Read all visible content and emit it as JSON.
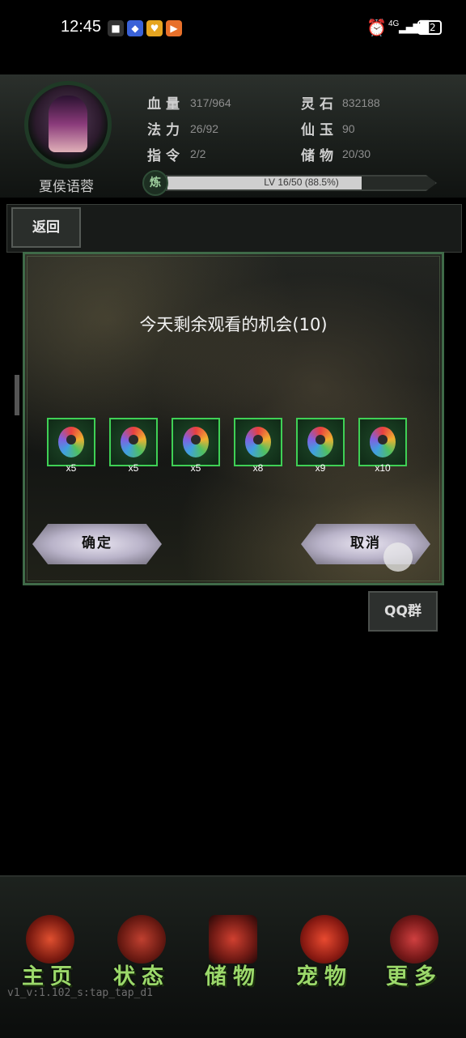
{
  "status_bar": {
    "time": "12:45",
    "network": "4G",
    "battery": "12"
  },
  "player": {
    "name": "夏侯语蓉",
    "stats": [
      {
        "label": "血量",
        "value": "317/964"
      },
      {
        "label": "法力",
        "value": "26/92"
      },
      {
        "label": "指令",
        "value": "2/2"
      },
      {
        "label": "灵石",
        "value": "832188"
      },
      {
        "label": "仙玉",
        "value": "90"
      },
      {
        "label": "储物",
        "value": "20/30"
      }
    ],
    "exp_badge": "炼",
    "exp_text": "LV 16/50 (88.5%)",
    "exp_progress": 0.885
  },
  "nav": {
    "back_label": "返回"
  },
  "dialog": {
    "title": "今天剩余观看的机会(10)",
    "rewards": [
      {
        "qty": "x5",
        "icon": "spirit-gem-icon"
      },
      {
        "qty": "x5",
        "icon": "spirit-gem-icon"
      },
      {
        "qty": "x5",
        "icon": "spirit-gem-icon"
      },
      {
        "qty": "x8",
        "icon": "spirit-gem-icon"
      },
      {
        "qty": "x9",
        "icon": "spirit-gem-icon"
      },
      {
        "qty": "x10",
        "icon": "spirit-gem-icon"
      }
    ],
    "confirm_label": "确定",
    "cancel_label": "取消"
  },
  "qq_label": "QQ群",
  "bottom_nav": [
    {
      "label": "主页",
      "color": "#c0392b"
    },
    {
      "label": "状态",
      "color": "#a83a2a"
    },
    {
      "label": "储物",
      "color": "#b8322a"
    },
    {
      "label": "宠物",
      "color": "#c9302c"
    },
    {
      "label": "更多",
      "color": "#b03a3a"
    }
  ],
  "version": "v1_v:1.102_s:tap_tap_d1"
}
